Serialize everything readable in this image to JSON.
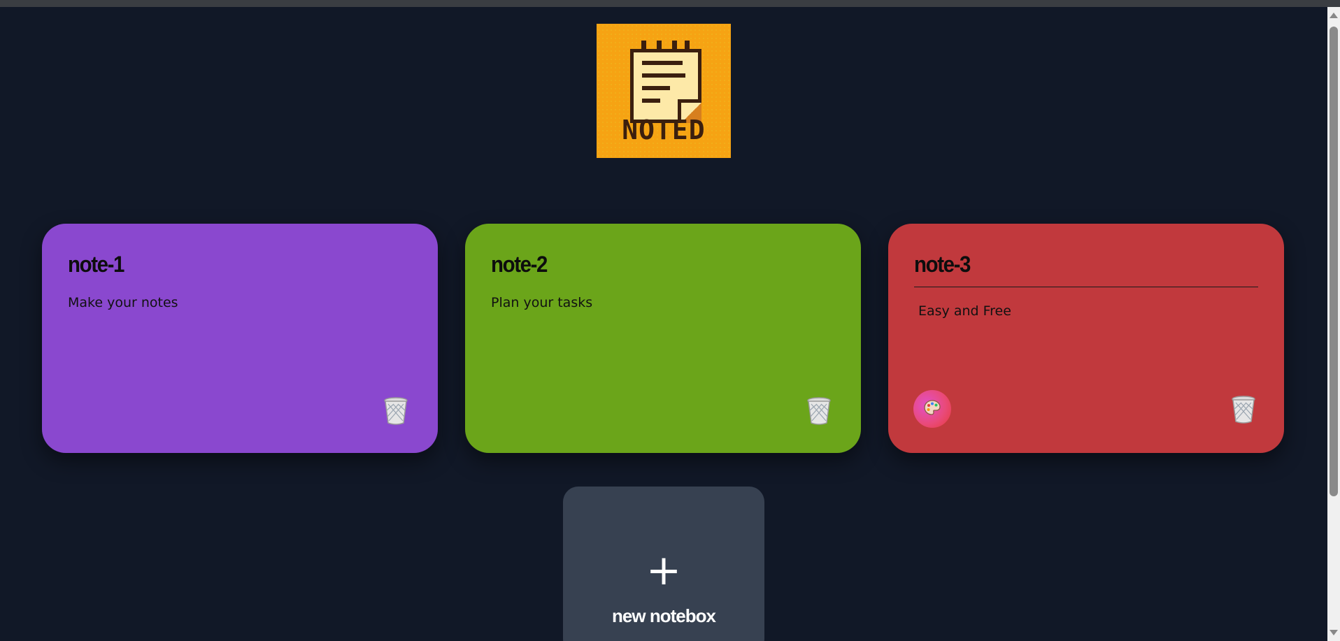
{
  "logo": {
    "text": "NOTED"
  },
  "notes": [
    {
      "title": "note-1",
      "body": "Make your notes",
      "color": "#8a48cf"
    },
    {
      "title": "note-2",
      "body": "Plan your tasks",
      "color": "#6ba51a"
    },
    {
      "title": "note-3",
      "body": "Easy and Free",
      "color": "#c1393d"
    }
  ],
  "new_notebox": {
    "plus": "+",
    "label": "new notebox"
  },
  "colors": {
    "background": "#111827",
    "new_notebox_bg": "#374151",
    "logo_bg": "#f6a313"
  },
  "icons": {
    "delete": "trash-icon",
    "color_picker": "palette-icon"
  }
}
